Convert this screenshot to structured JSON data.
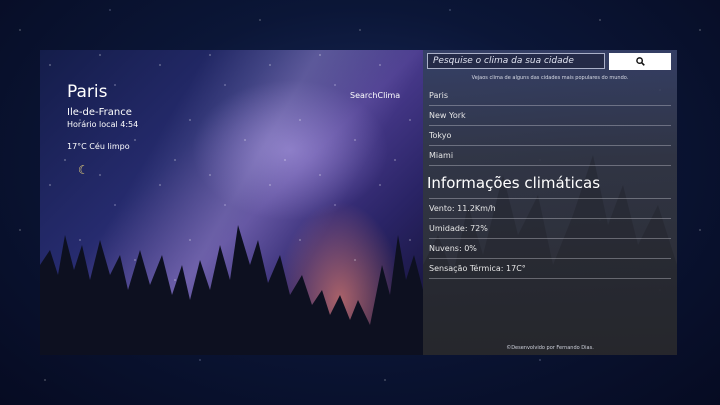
{
  "hero": {
    "city": "Paris",
    "region": "Ile-de-France",
    "local_time": "Horário local 4:54",
    "weather": "17°C Céu limpo",
    "brand": "SearchClima",
    "moon_icon": "crescent-moon-icon"
  },
  "search": {
    "placeholder": "Pesquise o clima da sua cidade",
    "button_icon": "search-icon"
  },
  "sidebar": {
    "subtitle": "Vejaos clima de alguns das cidades mais populares do mundo.",
    "cities": [
      "Paris",
      "New York",
      "Tokyo",
      "Miami"
    ],
    "section_title": "Informações climáticas",
    "details": [
      "Vento: 11.2Km/h",
      "Umidade: 72%",
      "Nuvens: 0%",
      "Sensação Térmica: 17C°"
    ],
    "footer": "©Desenvolvido por Fernando Dias."
  }
}
